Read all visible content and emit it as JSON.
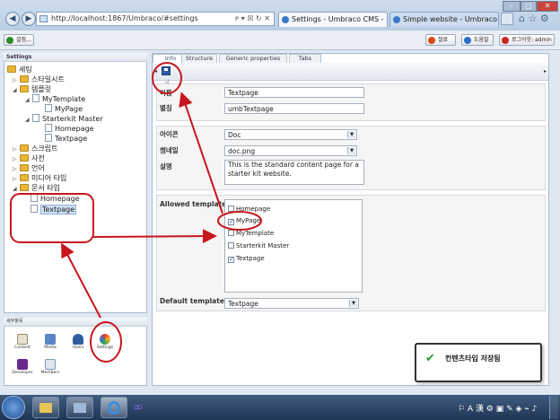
{
  "browser": {
    "address": "http://localhost:1867/Umbraco/#settings",
    "tabs": [
      "Settings - Umbraco CMS - ...",
      "Simple website - Umbraco C..."
    ]
  },
  "topbar": {
    "left_button": "설정...",
    "buttons": [
      "절료",
      "도움말",
      "로그아웃: admin"
    ]
  },
  "tree": {
    "header": "Settings",
    "root": "세팅",
    "stylesheets": "스타일시트",
    "templates": "템플릿",
    "mytemplate": "MyTemplate",
    "mypage": "MyPage",
    "starterkit_master": "Starterkit Master",
    "homepage": "Homepage",
    "textpage": "Textpage",
    "scripts": "스크립트",
    "dictionary": "사전",
    "languages": "언어",
    "media_types": "미디어 타입",
    "document_types": "문서 타입",
    "dt_homepage": "Homepage",
    "dt_textpage": "Textpage"
  },
  "sections": {
    "header": "세부항목",
    "items": [
      "Content",
      "Media",
      "Users",
      "Settings",
      "Developer",
      "Members"
    ]
  },
  "panel": {
    "tabs": [
      "Info",
      "Structure",
      "Generic properties",
      "Tabs"
    ],
    "name_label": "이름",
    "alias_label": "별칭",
    "name_value": "Textpage",
    "alias_value": "umbTextpage",
    "icon_label": "아이콘",
    "thumb_label": "썸네일",
    "desc_label": "설명",
    "icon_value": "Doc",
    "thumb_value": "doc.png",
    "description": "This is the standard content page for a starter kit website.",
    "allowed_label": "Allowed templates",
    "templates": [
      {
        "name": "Homepage",
        "checked": false
      },
      {
        "name": "MyPage",
        "checked": true
      },
      {
        "name": "MyTemplate",
        "checked": false
      },
      {
        "name": "Starterkit Master",
        "checked": false
      },
      {
        "name": "Textpage",
        "checked": true
      }
    ],
    "default_label": "Default template",
    "default_value": "Textpage"
  },
  "notification": {
    "text": "컨텐츠타입 저장됨"
  }
}
